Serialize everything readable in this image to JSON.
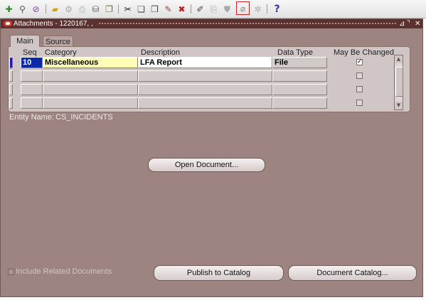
{
  "toolbar": {
    "icons": [
      "new-record-icon",
      "find-icon",
      "navigator-icon",
      "save-icon",
      "switch-responsibility-icon",
      "print-icon",
      "close-form-icon",
      "cut-icon",
      "copy-icon",
      "paste-icon",
      "clear-record-icon",
      "delete-record-icon",
      "edit-field-icon",
      "zoom-icon",
      "translations-icon",
      "attachments-icon",
      "folder-tools-icon",
      "help-icon"
    ]
  },
  "window": {
    "title": "Attachments - 1220167, ,",
    "controls": [
      "restore",
      "maximize",
      "close"
    ]
  },
  "tabs": [
    {
      "label": "Main"
    },
    {
      "label": "Source"
    }
  ],
  "grid": {
    "headers": {
      "seq": "Seq",
      "category": "Category",
      "description": "Description",
      "data_type": "Data Type",
      "may_be_changed": "May Be Changed"
    },
    "rows": [
      {
        "seq": "10",
        "category": "Miscellaneous",
        "description": "LFA Report",
        "data_type": "File",
        "may_be_changed": true
      },
      {
        "seq": "",
        "category": "",
        "description": "",
        "data_type": "",
        "may_be_changed": false
      },
      {
        "seq": "",
        "category": "",
        "description": "",
        "data_type": "",
        "may_be_changed": false
      },
      {
        "seq": "",
        "category": "",
        "description": "",
        "data_type": "",
        "may_be_changed": false
      }
    ]
  },
  "entity": {
    "label": "Entity Name:",
    "value": "CS_INCIDENTS"
  },
  "buttons": {
    "open_document": "Open Document...",
    "publish_to_catalog": "Publish to Catalog",
    "document_catalog": "Document Catalog..."
  },
  "include_related": {
    "label": "Include Related Documents",
    "checked": false,
    "enabled": false
  },
  "colors": {
    "window_bg": "#9e8480",
    "title_bar": "#5c3230",
    "required_field": "#ffffb6",
    "current_record": "#0a2aa8"
  }
}
